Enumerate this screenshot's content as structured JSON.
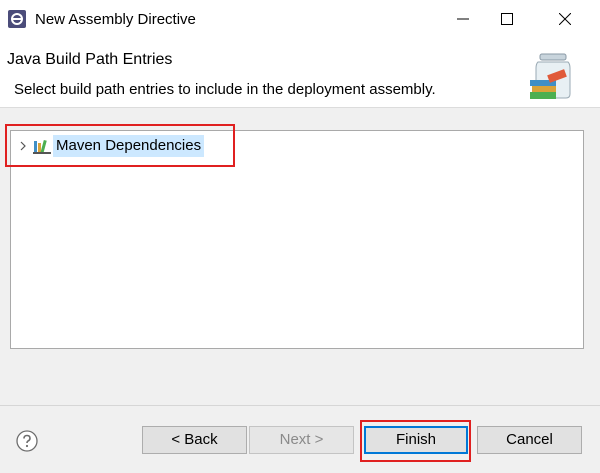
{
  "window": {
    "title": "New Assembly Directive",
    "icon": "eclipse-icon"
  },
  "header": {
    "title": "Java Build Path Entries",
    "message": "Select build path entries to include in the deployment assembly.",
    "banner_icon": "library-jar-icon"
  },
  "tree": {
    "items": [
      {
        "label": "Maven Dependencies",
        "icon": "library-icon",
        "expanded": false,
        "selected": true
      }
    ]
  },
  "footer": {
    "help_icon": "question-mark-icon",
    "back_label": "< Back",
    "next_label": "Next >",
    "finish_label": "Finish",
    "cancel_label": "Cancel",
    "next_enabled": false
  },
  "colors": {
    "selection": "#cce8ff",
    "annotation_red": "#e02020",
    "default_button_border": "#0078d7",
    "dialog_bg": "#f0f0f0"
  }
}
